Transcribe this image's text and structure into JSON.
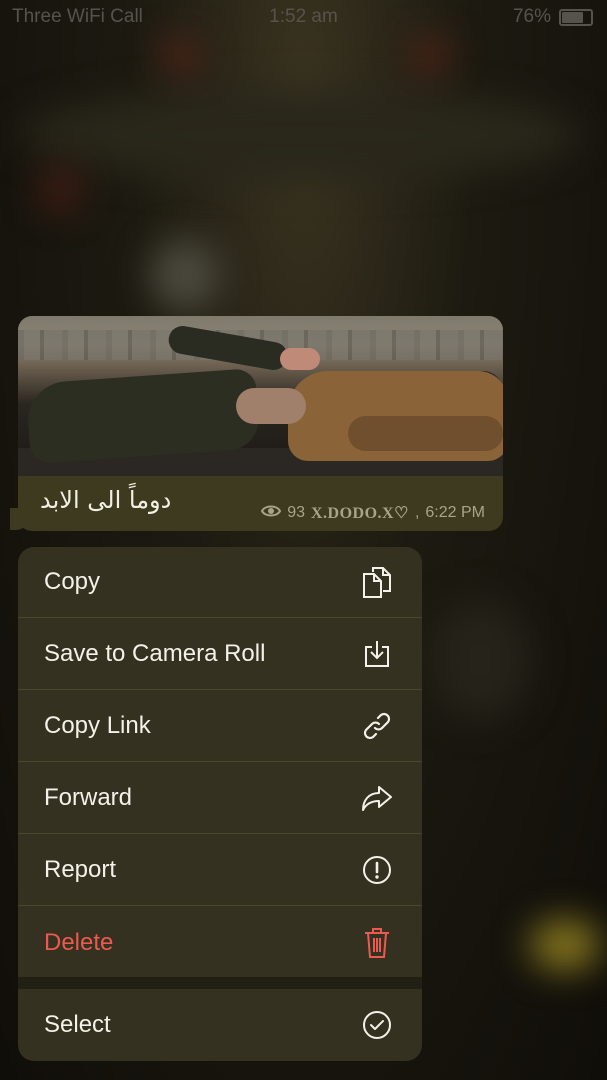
{
  "status_bar": {
    "carrier": "Three WiFi Call",
    "time": "1:52 am",
    "battery": "76%",
    "battery_level": 0.76
  },
  "message": {
    "caption": "دوماً الى الابد",
    "views": "93",
    "signature": "X.DODO.X♡",
    "time": "6:22 PM"
  },
  "menu": {
    "items": [
      {
        "label": "Copy",
        "icon": "copy-icon"
      },
      {
        "label": "Save to Camera Roll",
        "icon": "download-icon"
      },
      {
        "label": "Copy Link",
        "icon": "link-icon"
      },
      {
        "label": "Forward",
        "icon": "forward-icon"
      },
      {
        "label": "Report",
        "icon": "report-icon"
      },
      {
        "label": "Delete",
        "icon": "trash-icon",
        "color": "#eb5a50"
      }
    ],
    "select": {
      "label": "Select",
      "icon": "checkmark-circle-icon"
    }
  },
  "colors": {
    "menu_bg": "#343120",
    "bubble_bg": "#3d3a20",
    "danger": "#eb5a50"
  }
}
